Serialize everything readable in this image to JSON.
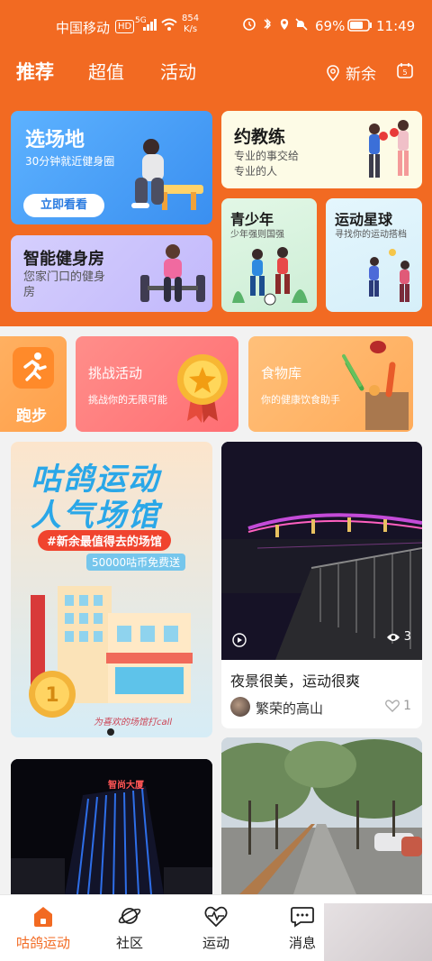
{
  "status": {
    "carrier": "中国移动",
    "hd": "HD",
    "network": "5G",
    "speed_value": "854",
    "speed_unit": "K/s",
    "battery_pct": "69%",
    "time": "11:49"
  },
  "topnav": {
    "tabs": [
      "推荐",
      "超值",
      "活动"
    ],
    "location": "新余"
  },
  "cards": {
    "venue": {
      "title": "选场地",
      "sub": "30分钟就近健身圈",
      "button": "立即看看"
    },
    "gym": {
      "title": "智能健身房",
      "sub": "您家门口的健身房"
    },
    "coach": {
      "title": "约教练",
      "sub_line1": "专业的事交给",
      "sub_line2": "专业的人"
    },
    "youth": {
      "title": "青少年",
      "sub": "少年强则国强"
    },
    "star": {
      "title": "运动星球",
      "sub": "寻找你的运动搭档"
    },
    "run": {
      "title": "跑步"
    },
    "challenge": {
      "title": "挑战活动",
      "sub": "挑战你的无限可能"
    },
    "food": {
      "title": "食物库",
      "sub": "你的健康饮食助手"
    }
  },
  "banner": {
    "line1": "咕鸽运动",
    "line2": "人气场馆",
    "tag": "#新余最值得去的场馆",
    "reward": "50000咕币免费送",
    "footer": "为喜欢的场馆打call"
  },
  "post": {
    "views": "3",
    "caption": "夜景很美，运动很爽",
    "author": "繁荣的高山",
    "likes": "1"
  },
  "photo2": {
    "sign": "智尚大厦"
  },
  "bottomnav": {
    "items": [
      "咕鸽运动",
      "社区",
      "运动",
      "消息"
    ]
  },
  "colors": {
    "brand": "#f26a22"
  }
}
